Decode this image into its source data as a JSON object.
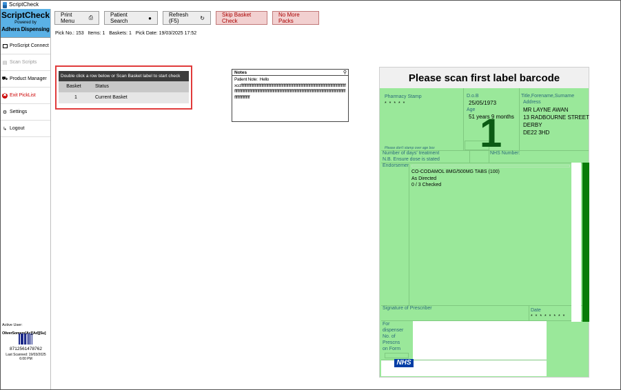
{
  "window": {
    "title": "ScriptCheck"
  },
  "brand": {
    "name": "ScriptCheck",
    "powered_by": "Powered by",
    "company": "Adhera Dispensing"
  },
  "sidebar": {
    "items": [
      {
        "label": "ProScript Connect",
        "icon": "box-icon"
      },
      {
        "label": "Scan Scripts",
        "icon": "scan-icon",
        "disabled": true
      },
      {
        "label": "Product Manager",
        "icon": "truck-icon"
      },
      {
        "label": "Exit PickList",
        "icon": "exit-icon"
      },
      {
        "label": "Settings",
        "icon": "gear-icon"
      },
      {
        "label": "Logout",
        "icon": "logout-icon"
      }
    ],
    "active_user_label": "Active User:",
    "user_name": "OliverSomers[Ac][Ad][Su]",
    "card_id": "8712561478762",
    "last_scanned": "Last Scanned: 19/03/2025",
    "last_scanned_time": "6:00 PM"
  },
  "toolbar": {
    "print_menu": "Print Menu",
    "patient_search": "Patient Search",
    "refresh": "Refresh (F5)",
    "skip_basket": "Skip Basket Check",
    "no_more_packs": "No More Packs"
  },
  "pick_info": {
    "pick_no": "Pick No.: 153",
    "items": "Items: 1",
    "baskets": "Baskets: 1",
    "pick_date": "Pick Date: 19/03/2025 17:52"
  },
  "basket_panel": {
    "instruction": "Double click a row below or Scan Basket label to start check",
    "columns": [
      "Basket",
      "Status"
    ],
    "rows": [
      {
        "basket": "1",
        "status": "Current Basket"
      }
    ]
  },
  "notes": {
    "title": "Notes",
    "text": "Patient Note:  Hello\nxccffffffffffffffffffffffffffffffffffffffffffffffffffffffffffffffffffffffffffffffffffffffffffffffffffffffffffffffffffffffffffffffffffffffffffffffffffffffffffffffffffffffffffffffffffffffffffffffffffffffffffffffffffffffffffffffffffffffffffffffffff"
  },
  "prescription": {
    "header": "Please scan first label barcode",
    "pharmacy_stamp_label": "Pharmacy Stamp",
    "pharmacy_stamp_value": "* * * * *",
    "dob_label": "D.o.B",
    "dob_value": "25/05/1973",
    "age_label": "Age",
    "age_value": "51 years 9 months",
    "basket_number": "1",
    "name_label": "Title,Forename,Surname",
    "address_label": "Address",
    "patient_name": "MR LAYNE AWAN",
    "address_line1": "13 RADBOURNE STREET",
    "address_line2": "DERBY",
    "address_line3": "DE22 3HD",
    "age_note": "Please don't stamp over age box",
    "days_treatment": "Number of days' treatment",
    "dose_note": "N.B. Ensure dose is stated",
    "nhs_number_label": "NHS Number:",
    "endorsements_label": "Endorsements",
    "drug": "CO-CODAMOL 8MG/500MG TABS (100)",
    "directions": "As Directed",
    "checked": "0 / 3 Checked",
    "signature_label": "Signature of Prescriber",
    "date_label": "Date",
    "date_value": "* * * * * * * *",
    "dispenser_line1": "For",
    "dispenser_line2": "dispenser",
    "dispenser_line3": "No. of",
    "dispenser_line4": "Prescns",
    "dispenser_line5": "on Form",
    "nhs_logo": "NHS"
  },
  "colors": {
    "form_green": "#9ae89a",
    "dark_green": "#097c09",
    "highlight_red": "#e03a3a",
    "brand_blue": "#5ab1e6"
  }
}
